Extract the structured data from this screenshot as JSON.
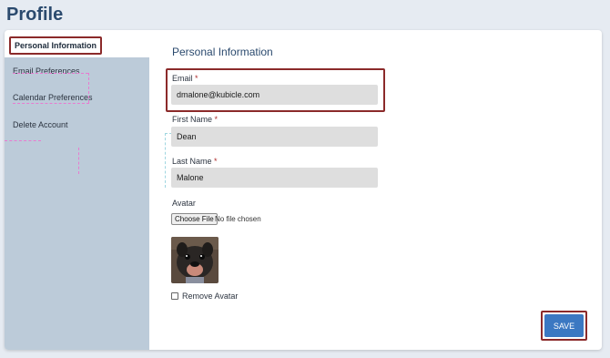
{
  "page": {
    "title": "Profile"
  },
  "sidebar": {
    "items": [
      {
        "label": "Personal Information",
        "active": true
      },
      {
        "label": "Email Preferences"
      },
      {
        "label": "Calendar Preferences"
      },
      {
        "label": "Delete Account"
      }
    ]
  },
  "form": {
    "section_title": "Personal Information",
    "email": {
      "label": "Email",
      "required_mark": "*",
      "value": "dmalone@kubicle.com"
    },
    "first_name": {
      "label": "First Name",
      "required_mark": "*",
      "value": "Dean"
    },
    "last_name": {
      "label": "Last Name",
      "required_mark": "*",
      "value": "Malone"
    },
    "avatar": {
      "label": "Avatar",
      "choose_button": "Choose File",
      "file_status": "No file chosen",
      "image_alt": "dog-avatar"
    },
    "remove_avatar": {
      "label": "Remove Avatar",
      "checked": false
    },
    "save_button": "SAVE"
  },
  "colors": {
    "accent": "#3b78c2",
    "sidebar_bg": "#bccbd9",
    "title": "#2b4a6e",
    "highlight_border": "#8b2a2a"
  }
}
